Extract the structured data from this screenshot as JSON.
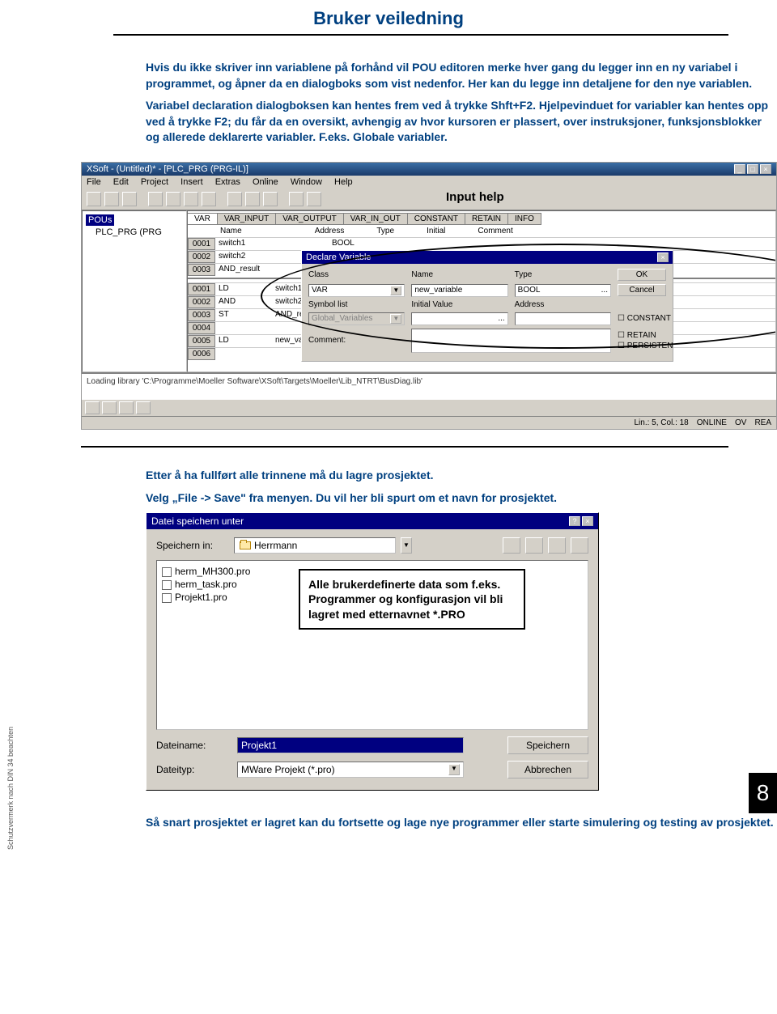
{
  "page": {
    "title": "Bruker veiledning",
    "para1": "Hvis du ikke skriver inn variablene på forhånd vil POU editoren merke hver gang du legger inn en ny variabel i programmet, og åpner da en dialogboks som vist nedenfor. Her kan du legge inn detaljene for den nye variablen.",
    "para2": "Variabel declaration dialogboksen kan hentes frem ved å trykke Shft+F2. Hjelpevinduet for variabler kan hentes opp ved å trykke F2; du får da en oversikt, avhengig av hvor kursoren er plassert, over instruksjoner, funksjonsblokker og allerede deklarerte variabler. F.eks. Globale variabler.",
    "para3": "Etter å ha fullført alle trinnene må du lagre prosjektet.",
    "para4": "Velg „File -> Save\" fra menyen. Du vil her bli spurt om et navn for prosjektet.",
    "para5": "Så snart prosjektet er lagret kan du fortsette og lage nye programmer eller starte simulering og testing av prosjektet.",
    "chapter": "8",
    "side_note": "Schutzvermerk nach DIN 34 beachten"
  },
  "app": {
    "title": "XSoft - (Untitled)* - [PLC_PRG (PRG-IL)]",
    "menu": [
      "File",
      "Edit",
      "Project",
      "Insert",
      "Extras",
      "Online",
      "Window",
      "Help"
    ],
    "input_help_label": "Input help",
    "tree_root": "POUs",
    "tree_item": "PLC_PRG (PRG",
    "var_tabs": [
      "VAR",
      "VAR_INPUT",
      "VAR_OUTPUT",
      "VAR_IN_OUT",
      "CONSTANT",
      "RETAIN",
      "INFO"
    ],
    "grid_headers": [
      "Name",
      "Address",
      "Type",
      "Initial",
      "Comment"
    ],
    "var_rows": [
      {
        "n": "0001",
        "name": "switch1",
        "type": "BOOL"
      },
      {
        "n": "0002",
        "name": "switch2",
        "type": ""
      },
      {
        "n": "0003",
        "name": "AND_result",
        "type": ""
      }
    ],
    "code_rows": [
      {
        "n": "0001",
        "op": "LD",
        "arg": "switch1"
      },
      {
        "n": "0002",
        "op": "AND",
        "arg": "switch2"
      },
      {
        "n": "0003",
        "op": "ST",
        "arg": "AND_result"
      },
      {
        "n": "0004",
        "op": "",
        "arg": ""
      },
      {
        "n": "0005",
        "op": "LD",
        "arg": "new_variable"
      },
      {
        "n": "0006",
        "op": "",
        "arg": ""
      }
    ],
    "msg": "Loading library 'C:\\Programme\\Moeller Software\\XSoft\\Targets\\Moeller\\Lib_NTRT\\BusDiag.lib'",
    "status_pos": "Lin.: 5, Col.: 18",
    "status_mode": "ONLINE",
    "status_ov": "OV",
    "status_rea": "REA"
  },
  "declare": {
    "title": "Declare Variable",
    "labels": {
      "class": "Class",
      "name": "Name",
      "type": "Type",
      "symlist": "Symbol list",
      "initval": "Initial Value",
      "address": "Address",
      "comment": "Comment:"
    },
    "class_val": "VAR",
    "name_val": "new_variable",
    "type_val": "BOOL",
    "symlist_val": "Global_Variables",
    "ok": "OK",
    "cancel": "Cancel",
    "chk_constant": "CONSTANT",
    "chk_retain": "RETAIN",
    "chk_persist": "PERSISTEN"
  },
  "save": {
    "title": "Datei speichern unter",
    "save_in_label": "Speichern in:",
    "folder": "Herrmann",
    "files": [
      "herm_MH300.pro",
      "herm_task.pro",
      "Projekt1.pro"
    ],
    "filename_label": "Dateiname:",
    "filename_val": "Projekt1",
    "filetype_label": "Dateityp:",
    "filetype_val": "MWare Projekt (*.pro)",
    "save_btn": "Speichern",
    "cancel_btn": "Abbrechen",
    "callout": "Alle brukerdefinerte data som f.eks. Programmer og konfigurasjon vil bli lagret med etternavnet *.PRO"
  }
}
